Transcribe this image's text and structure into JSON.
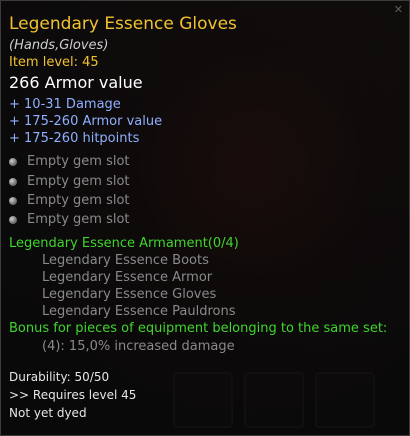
{
  "item": {
    "name": "Legendary Essence Gloves",
    "type": "(Hands,Gloves)",
    "level": "Item level: 45",
    "armor": "266 Armor value",
    "bonuses": [
      "+ 10-31 Damage",
      "+ 175-260 Armor value",
      "+ 175-260 hitpoints"
    ],
    "gem_slots": [
      "Empty gem slot",
      "Empty gem slot",
      "Empty gem slot",
      "Empty gem slot"
    ]
  },
  "set": {
    "title": "Legendary Essence Armament(0/4)",
    "items": [
      "Legendary Essence Boots",
      "Legendary Essence Armor",
      "Legendary Essence Gloves",
      "Legendary Essence Pauldrons"
    ],
    "bonus_header": "Bonus for pieces of equipment belonging to the same set:",
    "bonus": "(4): 15,0% increased damage"
  },
  "footer": {
    "durability": "Durability: 50/50",
    "requires": ">> Requires level 45",
    "dye": "Not yet dyed"
  },
  "colors": {
    "title": "#f2c230",
    "bonus": "#8fb0ff",
    "set": "#3fd62d",
    "inactive": "#8a8a8a"
  }
}
